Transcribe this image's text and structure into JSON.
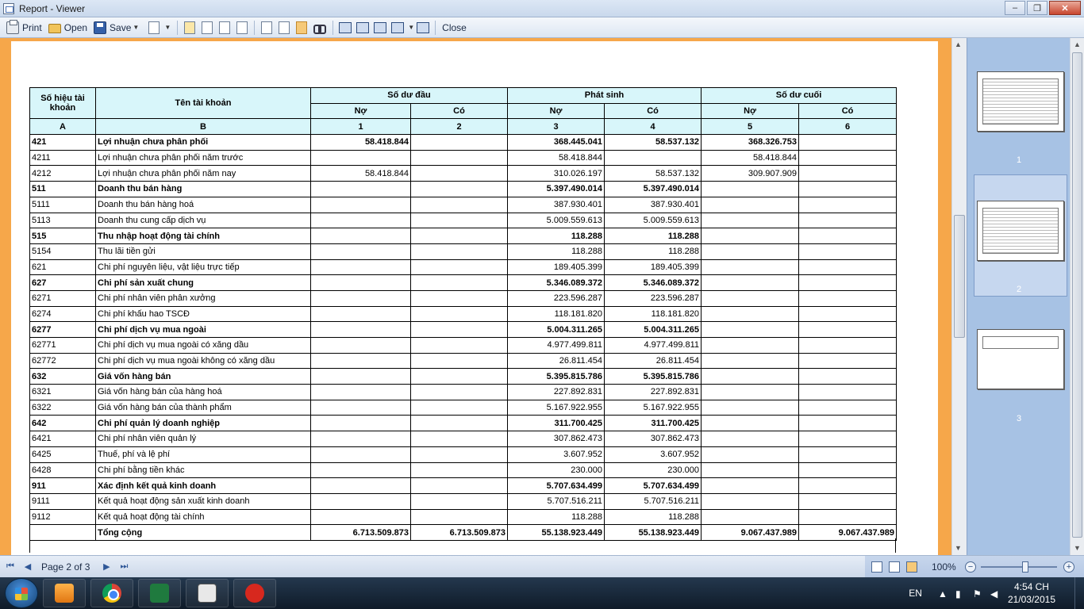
{
  "window": {
    "title": "Report - Viewer",
    "minimize_glyph": "–",
    "maximize_glyph": "❐",
    "close_glyph": "✕"
  },
  "toolbar": {
    "print_label": "Print",
    "open_label": "Open",
    "save_label": "Save",
    "close_label": "Close",
    "caret": "▼"
  },
  "table": {
    "headers": {
      "account_code": "Số hiệu tài khoản",
      "account_name": "Tên tài khoản",
      "opening_balance": "Số dư đầu",
      "transactions": "Phát sinh",
      "closing_balance": "Số dư cuối",
      "debit": "Nợ",
      "credit": "Có",
      "idx_a": "A",
      "idx_b": "B",
      "idx_1": "1",
      "idx_2": "2",
      "idx_3": "3",
      "idx_4": "4",
      "idx_5": "5",
      "idx_6": "6"
    },
    "rows": [
      {
        "code": "421",
        "name": "Lợi nhuận chưa phân phối",
        "d1": "58.418.844",
        "c1": "",
        "d2": "368.445.041",
        "c2": "58.537.132",
        "d3": "368.326.753",
        "c3": "",
        "bold": true
      },
      {
        "code": "4211",
        "name": "Lợi nhuận chưa phân phối năm trước",
        "d1": "",
        "c1": "",
        "d2": "58.418.844",
        "c2": "",
        "d3": "58.418.844",
        "c3": "",
        "bold": false
      },
      {
        "code": "4212",
        "name": "Lợi nhuận chưa phân phối năm nay",
        "d1": "58.418.844",
        "c1": "",
        "d2": "310.026.197",
        "c2": "58.537.132",
        "d3": "309.907.909",
        "c3": "",
        "bold": false
      },
      {
        "code": "511",
        "name": "Doanh thu bán hàng",
        "d1": "",
        "c1": "",
        "d2": "5.397.490.014",
        "c2": "5.397.490.014",
        "d3": "",
        "c3": "",
        "bold": true
      },
      {
        "code": "5111",
        "name": "Doanh thu bán hàng hoá",
        "d1": "",
        "c1": "",
        "d2": "387.930.401",
        "c2": "387.930.401",
        "d3": "",
        "c3": "",
        "bold": false
      },
      {
        "code": "5113",
        "name": "Doanh thu cung cấp dịch vụ",
        "d1": "",
        "c1": "",
        "d2": "5.009.559.613",
        "c2": "5.009.559.613",
        "d3": "",
        "c3": "",
        "bold": false
      },
      {
        "code": "515",
        "name": "Thu nhập hoạt động tài chính",
        "d1": "",
        "c1": "",
        "d2": "118.288",
        "c2": "118.288",
        "d3": "",
        "c3": "",
        "bold": true
      },
      {
        "code": "5154",
        "name": "Thu lãi tiền gửi",
        "d1": "",
        "c1": "",
        "d2": "118.288",
        "c2": "118.288",
        "d3": "",
        "c3": "",
        "bold": false
      },
      {
        "code": "621",
        "name": "Chi phí nguyên liệu, vật liệu trực tiếp",
        "d1": "",
        "c1": "",
        "d2": "189.405.399",
        "c2": "189.405.399",
        "d3": "",
        "c3": "",
        "bold": false
      },
      {
        "code": "627",
        "name": "Chi phí sản xuất chung",
        "d1": "",
        "c1": "",
        "d2": "5.346.089.372",
        "c2": "5.346.089.372",
        "d3": "",
        "c3": "",
        "bold": true
      },
      {
        "code": "6271",
        "name": "Chi phí nhân viên phân xưởng",
        "d1": "",
        "c1": "",
        "d2": "223.596.287",
        "c2": "223.596.287",
        "d3": "",
        "c3": "",
        "bold": false
      },
      {
        "code": "6274",
        "name": "Chi phí khấu hao TSCĐ",
        "d1": "",
        "c1": "",
        "d2": "118.181.820",
        "c2": "118.181.820",
        "d3": "",
        "c3": "",
        "bold": false
      },
      {
        "code": "6277",
        "name": "Chi phí dịch vụ mua ngoài",
        "d1": "",
        "c1": "",
        "d2": "5.004.311.265",
        "c2": "5.004.311.265",
        "d3": "",
        "c3": "",
        "bold": true
      },
      {
        "code": "62771",
        "name": "Chi phí dịch vụ mua ngoài có xăng dầu",
        "d1": "",
        "c1": "",
        "d2": "4.977.499.811",
        "c2": "4.977.499.811",
        "d3": "",
        "c3": "",
        "bold": false
      },
      {
        "code": "62772",
        "name": "Chi phí dịch vụ mua ngoài không có xăng dầu",
        "d1": "",
        "c1": "",
        "d2": "26.811.454",
        "c2": "26.811.454",
        "d3": "",
        "c3": "",
        "bold": false
      },
      {
        "code": "632",
        "name": "Giá vốn hàng bán",
        "d1": "",
        "c1": "",
        "d2": "5.395.815.786",
        "c2": "5.395.815.786",
        "d3": "",
        "c3": "",
        "bold": true
      },
      {
        "code": "6321",
        "name": "Giá vốn hàng bán của hàng hoá",
        "d1": "",
        "c1": "",
        "d2": "227.892.831",
        "c2": "227.892.831",
        "d3": "",
        "c3": "",
        "bold": false
      },
      {
        "code": "6322",
        "name": "Giá vốn hàng bán của thành phẩm",
        "d1": "",
        "c1": "",
        "d2": "5.167.922.955",
        "c2": "5.167.922.955",
        "d3": "",
        "c3": "",
        "bold": false
      },
      {
        "code": "642",
        "name": "Chi phí quản lý doanh nghiệp",
        "d1": "",
        "c1": "",
        "d2": "311.700.425",
        "c2": "311.700.425",
        "d3": "",
        "c3": "",
        "bold": true
      },
      {
        "code": "6421",
        "name": "Chi phí nhân viên quản lý",
        "d1": "",
        "c1": "",
        "d2": "307.862.473",
        "c2": "307.862.473",
        "d3": "",
        "c3": "",
        "bold": false
      },
      {
        "code": "6425",
        "name": "Thuế, phí và lệ phí",
        "d1": "",
        "c1": "",
        "d2": "3.607.952",
        "c2": "3.607.952",
        "d3": "",
        "c3": "",
        "bold": false
      },
      {
        "code": "6428",
        "name": "Chi phí bằng tiền khác",
        "d1": "",
        "c1": "",
        "d2": "230.000",
        "c2": "230.000",
        "d3": "",
        "c3": "",
        "bold": false
      },
      {
        "code": "911",
        "name": "Xác định kết quả kinh doanh",
        "d1": "",
        "c1": "",
        "d2": "5.707.634.499",
        "c2": "5.707.634.499",
        "d3": "",
        "c3": "",
        "bold": true
      },
      {
        "code": "9111",
        "name": "Kết quả hoạt động sản xuất kinh doanh",
        "d1": "",
        "c1": "",
        "d2": "5.707.516.211",
        "c2": "5.707.516.211",
        "d3": "",
        "c3": "",
        "bold": false
      },
      {
        "code": "9112",
        "name": "Kết quả hoạt động tài chính",
        "d1": "",
        "c1": "",
        "d2": "118.288",
        "c2": "118.288",
        "d3": "",
        "c3": "",
        "bold": false
      },
      {
        "code": "",
        "name": "Tổng cộng",
        "d1": "6.713.509.873",
        "c1": "6.713.509.873",
        "d2": "55.138.923.449",
        "c2": "55.138.923.449",
        "d3": "9.067.437.989",
        "c3": "9.067.437.989",
        "bold": true
      }
    ]
  },
  "thumbnails": [
    {
      "label": "1"
    },
    {
      "label": "2"
    },
    {
      "label": "3"
    }
  ],
  "status": {
    "page_info": "Page 2 of 3",
    "zoom": "100%",
    "first_glyph": "⏮",
    "prev_glyph": "◀",
    "next_glyph": "▶",
    "last_glyph": "⏭",
    "zoom_out_glyph": "−",
    "zoom_in_glyph": "+"
  },
  "taskbar": {
    "language": "EN",
    "time": "4:54 CH",
    "date": "21/03/2015"
  }
}
